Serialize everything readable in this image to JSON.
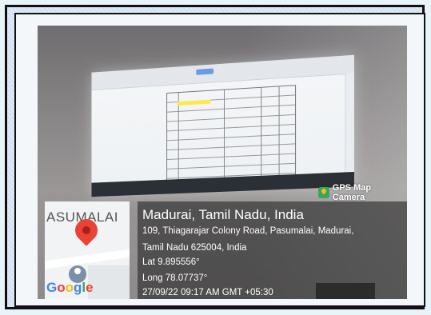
{
  "brand": {
    "name": "GPS Map Camera",
    "logo_icon": "gps-map-camera-logo-icon",
    "accent": "#3ba55d"
  },
  "map": {
    "area_label": "ASUMALAI",
    "pin_icon": "location-pin-icon",
    "person_icon": "street-view-icon",
    "provider": [
      "G",
      "o",
      "o",
      "g",
      "l",
      "e"
    ],
    "provider_colors": [
      "#4285f4",
      "#ea4335",
      "#fbbc05",
      "#4285f4",
      "#34a853",
      "#ea4335"
    ]
  },
  "location": {
    "title": "Madurai, Tamil Nadu, India",
    "address_line1": "109, Thiagarajar Colony Road, Pasumalai, Madurai,",
    "address_line2": "Tamil Nadu 625004, India",
    "lat": "Lat 9.895556°",
    "long": "Long 78.07737°",
    "timestamp": "27/09/22 09:17 AM GMT +05:30"
  }
}
